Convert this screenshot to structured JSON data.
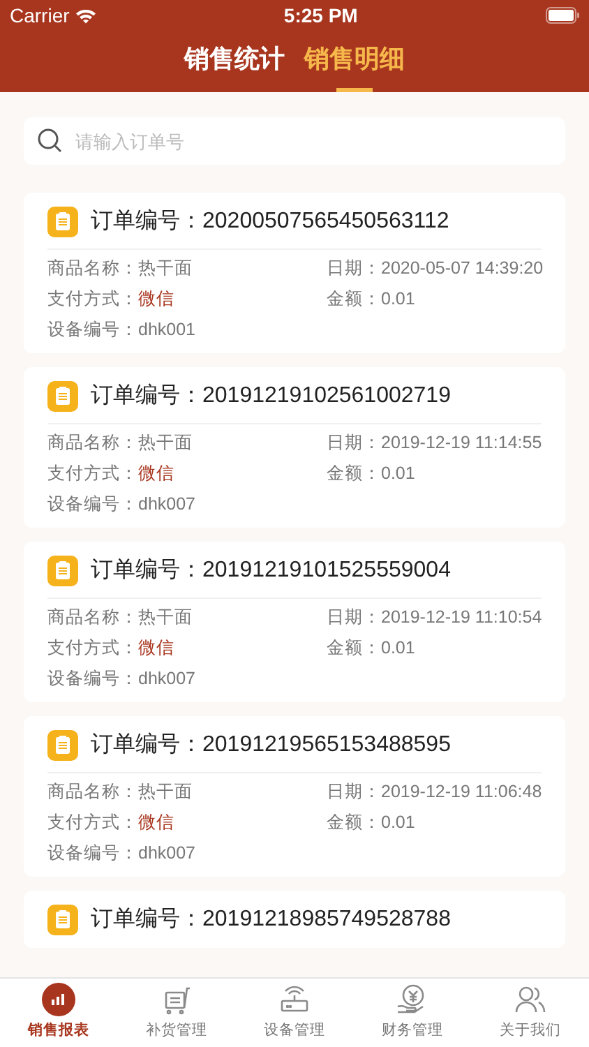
{
  "status_bar": {
    "carrier": "Carrier",
    "time": "5:25 PM"
  },
  "tabs": [
    {
      "label": "销售统计",
      "selected": false
    },
    {
      "label": "销售明细",
      "selected": true
    }
  ],
  "search": {
    "placeholder": "请输入订单号"
  },
  "orders": [
    {
      "title": "订单编号：",
      "number": "20200507565450563112",
      "fields": [
        {
          "label": "商品名称：",
          "value": "热干面"
        },
        {
          "label": "日期：",
          "value": "2020-05-07 14:39:20"
        },
        {
          "label": "支付方式：",
          "value": "微信",
          "highlight": true
        },
        {
          "label": "金额：",
          "value": "0.01"
        },
        {
          "label": "设备编号：",
          "value": "dhk001"
        }
      ]
    },
    {
      "title": "订单编号：",
      "number": "20191219102561002719",
      "fields": [
        {
          "label": "商品名称：",
          "value": "热干面"
        },
        {
          "label": "日期：",
          "value": "2019-12-19 11:14:55"
        },
        {
          "label": "支付方式：",
          "value": "微信",
          "highlight": true
        },
        {
          "label": "金额：",
          "value": "0.01"
        },
        {
          "label": "设备编号：",
          "value": "dhk007"
        }
      ]
    },
    {
      "title": "订单编号：",
      "number": "20191219101525559004",
      "fields": [
        {
          "label": "商品名称：",
          "value": "热干面"
        },
        {
          "label": "日期：",
          "value": "2019-12-19 11:10:54"
        },
        {
          "label": "支付方式：",
          "value": "微信",
          "highlight": true
        },
        {
          "label": "金额：",
          "value": "0.01"
        },
        {
          "label": "设备编号：",
          "value": "dhk007"
        }
      ]
    },
    {
      "title": "订单编号：",
      "number": "20191219565153488595",
      "fields": [
        {
          "label": "商品名称：",
          "value": "热干面"
        },
        {
          "label": "日期：",
          "value": "2019-12-19 11:06:48"
        },
        {
          "label": "支付方式：",
          "value": "微信",
          "highlight": true
        },
        {
          "label": "金额：",
          "value": "0.01"
        },
        {
          "label": "设备编号：",
          "value": "dhk007"
        }
      ]
    },
    {
      "title": "订单编号：",
      "number": "20191218985749528788"
    }
  ],
  "tab_bar": [
    {
      "label": "销售报表",
      "kind": "chart",
      "selected": true
    },
    {
      "label": "补货管理",
      "kind": "cart",
      "selected": false
    },
    {
      "label": "设备管理",
      "kind": "router",
      "selected": false
    },
    {
      "label": "财务管理",
      "kind": "money",
      "selected": false
    },
    {
      "label": "关于我们",
      "kind": "people",
      "selected": false
    }
  ]
}
